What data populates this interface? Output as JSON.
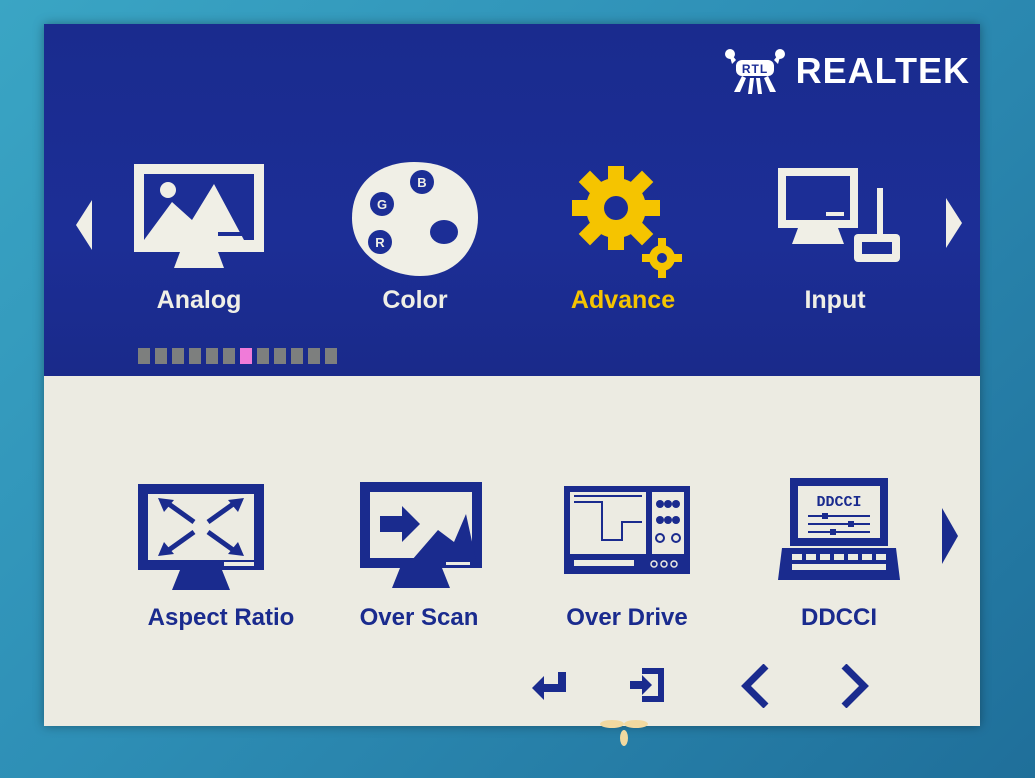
{
  "brand": {
    "name": "REALTEK"
  },
  "top_menu": {
    "items": [
      {
        "label": "Analog",
        "icon": "monitor-picture-icon"
      },
      {
        "label": "Color",
        "icon": "palette-icon"
      },
      {
        "label": "Advance",
        "icon": "gear-icon",
        "selected": true
      },
      {
        "label": "Input",
        "icon": "monitor-keyboard-icon"
      }
    ],
    "page_indicator": {
      "total": 12,
      "current": 6
    }
  },
  "sub_menu": {
    "items": [
      {
        "label": "Aspect Ratio",
        "icon": "aspect-ratio-icon"
      },
      {
        "label": "Over Scan",
        "icon": "over-scan-icon"
      },
      {
        "label": "Over Drive",
        "icon": "over-drive-icon"
      },
      {
        "label": "DDCCI",
        "icon": "ddcci-icon",
        "icon_text": "DDCCI"
      }
    ]
  },
  "nav_buttons": [
    "enter-icon",
    "exit-icon",
    "left-chevron-icon",
    "right-chevron-icon"
  ],
  "colors": {
    "header_bg": "#1c2e96",
    "body_bg": "#ecebe2",
    "accent_selected": "#f5c400",
    "label_light": "#f0efe6",
    "label_dark": "#1a2b8e",
    "page_dot": "#7d7f7e",
    "page_dot_active": "#f07bd9"
  }
}
